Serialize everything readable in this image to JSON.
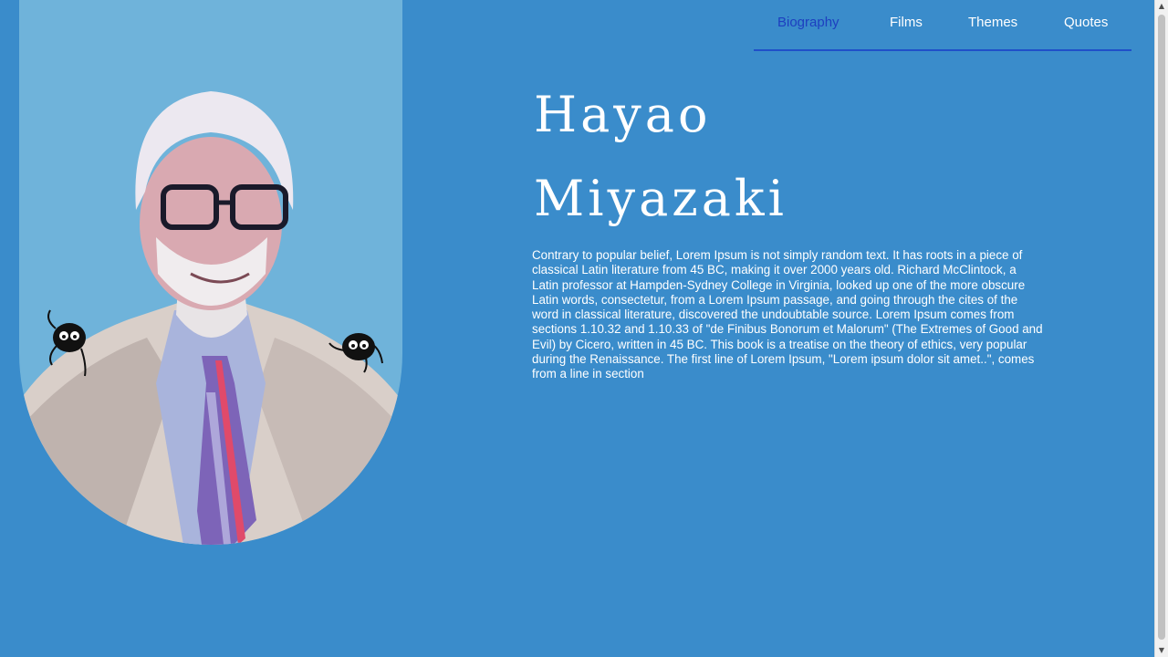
{
  "nav": {
    "items": [
      {
        "label": "Biography",
        "active": true
      },
      {
        "label": "Films",
        "active": false
      },
      {
        "label": "Themes",
        "active": false
      },
      {
        "label": "Quotes",
        "active": false
      }
    ]
  },
  "hero": {
    "first_name": "Hayao",
    "last_name": "Miyazaki"
  },
  "bio": {
    "text": "Contrary to popular belief, Lorem Ipsum is not simply random text. It has roots in a piece of classical Latin literature from 45 BC, making it over 2000 years old. Richard McClintock, a Latin professor at Hampden-Sydney College in Virginia, looked up one of the more obscure Latin words, consectetur, from a Lorem Ipsum passage, and going through the cites of the word in classical literature, discovered the undoubtable source. Lorem Ipsum comes from sections 1.10.32 and 1.10.33 of \"de Finibus Bonorum et Malorum\" (The Extremes of Good and Evil) by Cicero, written in 45 BC. This book is a treatise on the theory of ethics, very popular during the Renaissance. The first line of Lorem Ipsum, \"Lorem ipsum dolor sit amet..\", comes from a line in section"
  },
  "colors": {
    "background": "#3a8ccb",
    "portrait_panel": "#6fb3da",
    "nav_active": "#1d3fc0",
    "nav_underline": "#1f4fc9"
  }
}
